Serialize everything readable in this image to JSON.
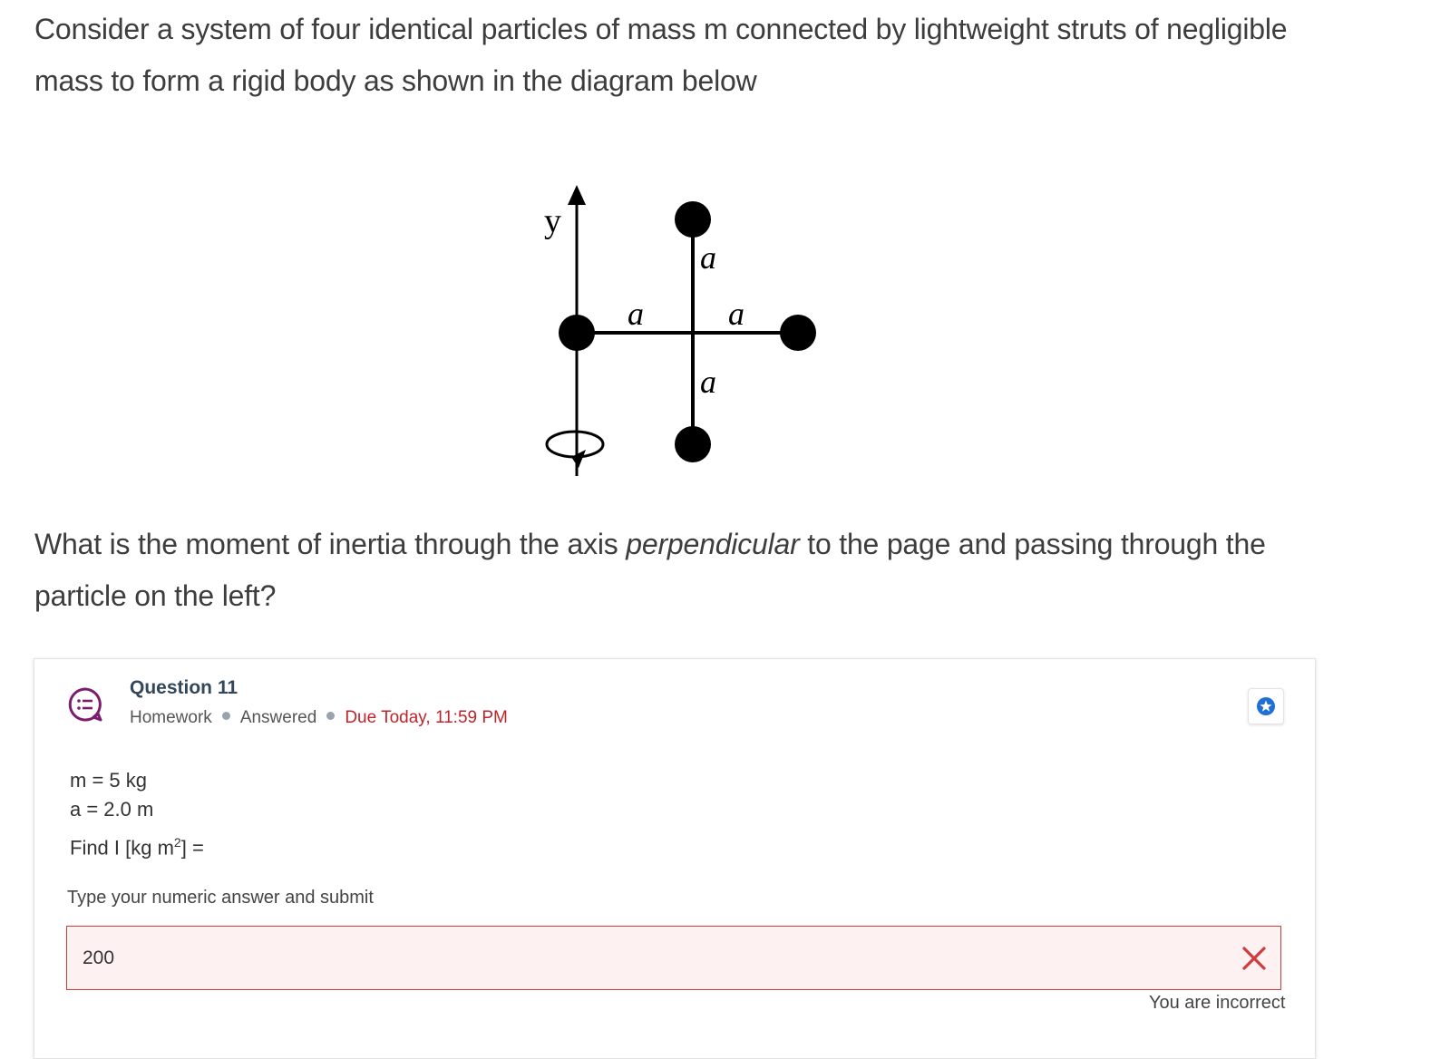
{
  "problem": {
    "intro": "Consider a system of four identical particles of mass m connected by lightweight struts of negligible mass to form a rigid body as shown in the diagram below",
    "question_part1": "What is the moment of inertia through the axis ",
    "question_emphasis": "perpendicular",
    "question_part2": " to the page and passing through the particle on the left?"
  },
  "diagram": {
    "axis_label": "y",
    "label_top": "a",
    "label_left": "a",
    "label_right": "a",
    "label_bottom": "a"
  },
  "card": {
    "title": "Question 11",
    "type": "Homework",
    "status": "Answered",
    "due": "Due Today, 11:59 PM",
    "givens": {
      "mass": "m = 5 kg",
      "length": "a = 2.0 m",
      "find_prefix": "Find I [kg m",
      "find_exp": "2",
      "find_suffix": "] ="
    },
    "instruction": "Type your numeric answer and submit",
    "answer_value": "200",
    "feedback": "You are incorrect",
    "colors": {
      "error": "#d13b3b",
      "due": "#c0242b",
      "star": "#1f6fd6",
      "icon": "#7a1d6e"
    },
    "icons": {
      "question_type": "list-chat-icon",
      "bookmark": "star-icon",
      "result": "close-icon"
    }
  }
}
